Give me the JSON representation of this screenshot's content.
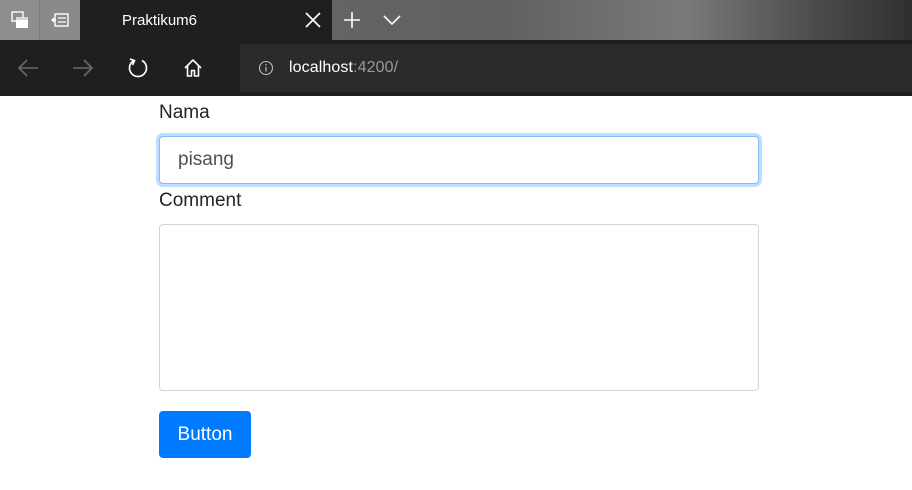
{
  "browser": {
    "tab": {
      "title": "Praktikum6"
    },
    "address_bar": {
      "host": "localhost",
      "port_path": ":4200/"
    }
  },
  "form": {
    "nama": {
      "label": "Nama",
      "value": "pisang"
    },
    "comment": {
      "label": "Comment",
      "value": ""
    },
    "submit_label": "Button"
  },
  "colors": {
    "primary": "#007bff",
    "focus_border": "#80bdff",
    "toolbar_bg": "#1f1f1f"
  },
  "icons": {
    "tab_aside_1": "tabs-aside-icon",
    "tab_aside_2": "tabs-set-aside-icon",
    "close": "close-icon",
    "new_tab": "plus-icon",
    "tab_list": "chevron-down-icon",
    "back": "arrow-left-icon",
    "forward": "arrow-right-icon",
    "refresh": "refresh-icon",
    "home": "home-icon",
    "info": "info-icon"
  }
}
